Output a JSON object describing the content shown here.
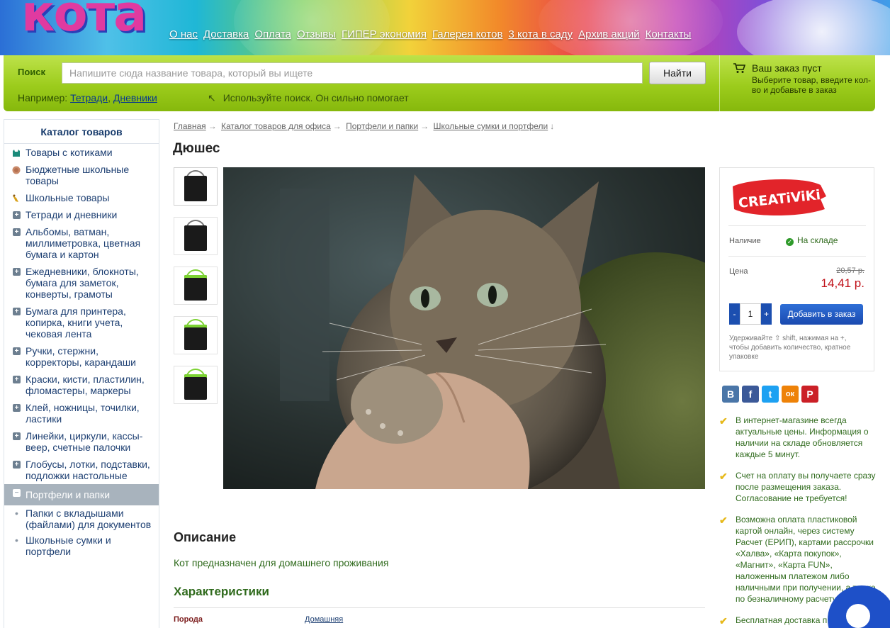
{
  "header": {
    "logo_text": "кота",
    "nav": [
      "О нас",
      "Доставка",
      "Оплата",
      "Отзывы",
      "ГИПЕР экономия",
      "Галерея котов",
      "3 кота в саду",
      "Архив акций",
      "Контакты"
    ]
  },
  "search": {
    "label": "Поиск",
    "placeholder": "Напишите сюда название товара, который вы ищете",
    "button": "Найти",
    "example_prefix": "Например:",
    "example_links": [
      "Тетради",
      "Дневники"
    ],
    "hint": "Используйте поиск. Он сильно помогает"
  },
  "cart": {
    "title": "Ваш заказ пуст",
    "subtitle": "Выберите товар, введите кол-во и добавьте в заказ"
  },
  "sidebar": {
    "title": "Каталог товаров",
    "items": [
      {
        "label": "Товары с котиками",
        "icon": "cat-icon"
      },
      {
        "label": "Бюджетные школьные товары",
        "icon": "coin-icon"
      },
      {
        "label": "Школьные товары",
        "icon": "bell-icon"
      },
      {
        "label": "Тетради и дневники",
        "icon": "plus-icon"
      },
      {
        "label": "Альбомы, ватман, миллиметровка, цветная бумага и картон",
        "icon": "plus-icon"
      },
      {
        "label": "Ежедневники, блокноты, бумага для заметок, конверты, грамоты",
        "icon": "plus-icon"
      },
      {
        "label": "Бумага для принтера, копирка, книги учета, чековая лента",
        "icon": "plus-icon"
      },
      {
        "label": "Ручки, стержни, корректоры, карандаши",
        "icon": "plus-icon"
      },
      {
        "label": "Краски, кисти, пластилин, фломастеры, маркеры",
        "icon": "plus-icon"
      },
      {
        "label": "Клей, ножницы, точилки, ластики",
        "icon": "plus-icon"
      },
      {
        "label": "Линейки, циркули, кассы-веер, счетные палочки",
        "icon": "plus-icon"
      },
      {
        "label": "Глобусы, лотки, подставки, подложки настольные",
        "icon": "plus-icon"
      }
    ],
    "active": {
      "label": "Портфели и папки",
      "icon": "minus-icon"
    },
    "subitems": [
      "Папки с вкладышами (файлами) для документов",
      "Школьные сумки и портфели"
    ]
  },
  "breadcrumbs": [
    "Главная",
    "Каталог товаров для офиса",
    "Портфели и папки",
    "Школьные сумки и портфели"
  ],
  "product": {
    "title": "Дюшес",
    "description_heading": "Описание",
    "description": "Кот предназначен для домашнего проживания",
    "characteristics_heading": "Характеристики",
    "characteristics": [
      {
        "key": "Порода",
        "value": "Домашняя"
      }
    ]
  },
  "buybox": {
    "brand": "CREATiViKi",
    "availability_label": "Наличие",
    "availability_value": "На складе",
    "price_label": "Цена",
    "old_price": "20,57 р.",
    "new_price": "14,41 р.",
    "qty_minus": "-",
    "qty_value": "1",
    "qty_plus": "+",
    "add_button": "Добавить в заказ",
    "tip": "Удерживайте ⇧ shift, нажимая на +, чтобы добавить количество, кратное упаковке"
  },
  "social": [
    {
      "label": "В",
      "icon": "vk-icon",
      "color": "#4a76a8"
    },
    {
      "label": "f",
      "icon": "facebook-icon",
      "color": "#3b5998"
    },
    {
      "label": "t",
      "icon": "twitter-icon",
      "color": "#1da1f2"
    },
    {
      "label": "ок",
      "icon": "odnoklassniki-icon",
      "color": "#ee8208"
    },
    {
      "label": "P",
      "icon": "pinterest-icon",
      "color": "#cb2027"
    }
  ],
  "features": [
    "В интернет-магазине всегда актуальные цены. Информация о наличии на складе обновляется каждые 5 минут.",
    "Счет на оплату вы получаете сразу после размещения заказа. Согласование не требуется!",
    "Возможна оплата пластиковой картой онлайн, через систему Расчет (ЕРИП), картами рассрочки «Халва», «Карта покупок», «Магнит», «Карта FUN», наложенным платежом либо наличными при получении, а также по безналичному расчету.",
    "Бесплатная доставка п"
  ]
}
